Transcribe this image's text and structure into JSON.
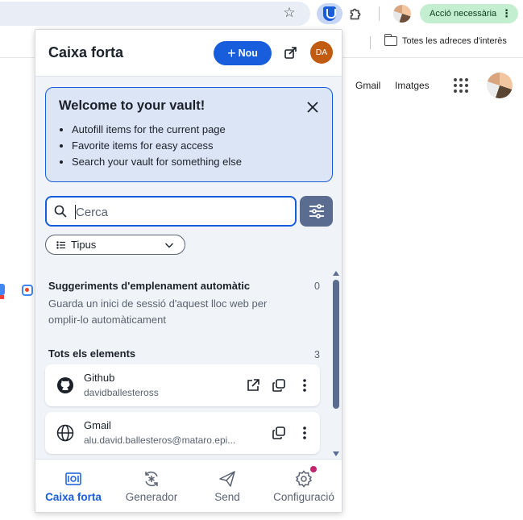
{
  "browser": {
    "action_pill": "Acció necessària",
    "bookmark_folder": "Totes les adreces d'interès"
  },
  "google": {
    "gmail": "Gmail",
    "images": "Imatges"
  },
  "popup": {
    "title": "Caixa forta",
    "new_button": "Nou",
    "avatar_initials": "DA",
    "welcome": {
      "title": "Welcome to your vault!",
      "bullets": [
        "Autofill items for the current page",
        "Favorite items for easy access",
        "Search your vault for something else"
      ]
    },
    "search": {
      "placeholder": "Cerca",
      "value": ""
    },
    "type_filter": "Tipus",
    "autofill_section": {
      "title": "Suggeriments d'emplenament automàtic",
      "count": "0",
      "description": "Guarda un inici de sessió d'aquest lloc web per omplir-lo automàticament"
    },
    "all_section": {
      "title": "Tots els elements",
      "count": "3"
    },
    "items": [
      {
        "name": "Github",
        "username": "davidballesteross",
        "icon": "github-icon"
      },
      {
        "name": "Gmail",
        "username": "alu.david.ballesteros@mataro.epi...",
        "icon": "globe-icon"
      }
    ],
    "nav": [
      {
        "label": "Caixa forta",
        "icon": "vault-icon",
        "active": true
      },
      {
        "label": "Generador",
        "icon": "generator-icon",
        "active": false
      },
      {
        "label": "Send",
        "icon": "send-icon",
        "active": false
      },
      {
        "label": "Configuració",
        "icon": "settings-icon",
        "active": false
      }
    ]
  },
  "colors": {
    "primary": "#175ddc",
    "welcome_bg": "#dbe5f6",
    "popup_bg": "#f0f4f8",
    "avatar": "#c25b12",
    "action_pill": "#c4eed0",
    "notification_dot": "#c0266f"
  }
}
